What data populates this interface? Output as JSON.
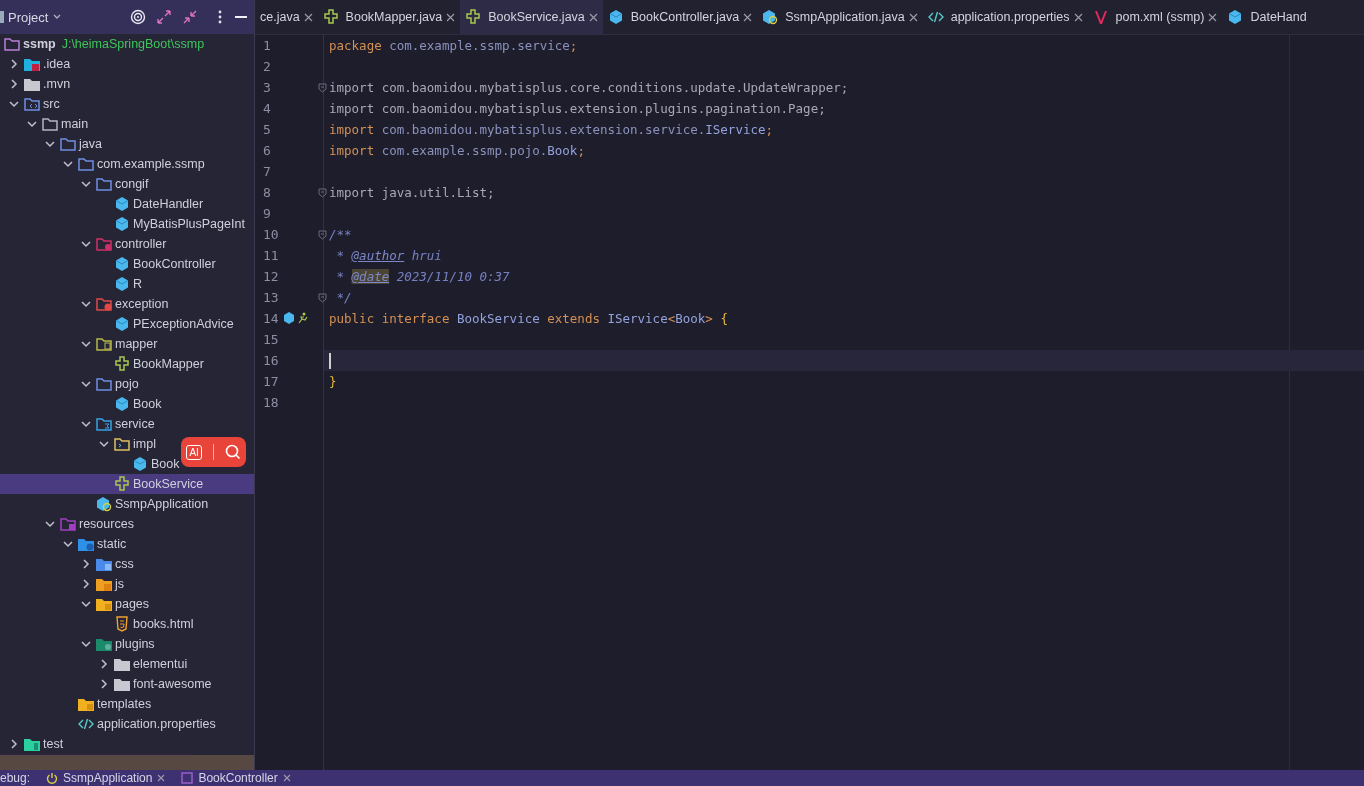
{
  "project_panel": {
    "title": "Project",
    "tree": [
      {
        "label": "ssmp",
        "path": "J:\\heimaSpringBoot\\ssmp",
        "kind": "module",
        "selected": false,
        "children": [
          {
            "label": ".idea",
            "kind": "idea-folder",
            "expanded": false,
            "selected": false
          },
          {
            "label": ".mvn",
            "kind": "plain-folder",
            "expanded": false,
            "selected": false
          },
          {
            "label": "src",
            "kind": "source-folder",
            "expanded": true,
            "selected": false,
            "children": [
              {
                "label": "main",
                "kind": "folder",
                "expanded": true,
                "selected": false,
                "children": [
                  {
                    "label": "java",
                    "kind": "package",
                    "expanded": true,
                    "selected": false,
                    "children": [
                      {
                        "label": "com.example.ssmp",
                        "kind": "package",
                        "expanded": true,
                        "selected": false,
                        "children": [
                          {
                            "label": "congif",
                            "kind": "package",
                            "expanded": true,
                            "selected": false,
                            "children": [
                              {
                                "label": "DateHandler",
                                "kind": "class",
                                "selected": false
                              },
                              {
                                "label": "MyBatisPlusPageInt",
                                "kind": "class",
                                "selected": false
                              }
                            ]
                          },
                          {
                            "label": "controller",
                            "kind": "controller-folder",
                            "expanded": true,
                            "selected": false,
                            "children": [
                              {
                                "label": "BookController",
                                "kind": "class",
                                "selected": false
                              },
                              {
                                "label": "R",
                                "kind": "class",
                                "selected": false
                              }
                            ]
                          },
                          {
                            "label": "exception",
                            "kind": "exception-folder",
                            "expanded": true,
                            "selected": false,
                            "children": [
                              {
                                "label": "PExceptionAdvice",
                                "kind": "class",
                                "selected": false
                              }
                            ]
                          },
                          {
                            "label": "mapper",
                            "kind": "mapper-folder",
                            "expanded": true,
                            "selected": false,
                            "children": [
                              {
                                "label": "BookMapper",
                                "kind": "interface",
                                "selected": false
                              }
                            ]
                          },
                          {
                            "label": "pojo",
                            "kind": "package",
                            "expanded": true,
                            "selected": false,
                            "children": [
                              {
                                "label": "Book",
                                "kind": "class",
                                "selected": false
                              }
                            ]
                          },
                          {
                            "label": "service",
                            "kind": "service-folder",
                            "expanded": true,
                            "selected": false,
                            "children": [
                              {
                                "label": "impl",
                                "kind": "impl-folder",
                                "expanded": true,
                                "selected": false,
                                "children": [
                                  {
                                    "label": "Book",
                                    "kind": "class",
                                    "selected": false
                                  }
                                ]
                              },
                              {
                                "label": "BookService",
                                "kind": "interface",
                                "selected": true
                              }
                            ]
                          },
                          {
                            "label": "SsmpApplication",
                            "kind": "app",
                            "selected": false
                          }
                        ]
                      }
                    ]
                  },
                  {
                    "label": "resources",
                    "kind": "resources-folder",
                    "expanded": true,
                    "selected": false,
                    "children": [
                      {
                        "label": "static",
                        "kind": "web-folder",
                        "expanded": true,
                        "selected": false,
                        "children": [
                          {
                            "label": "css",
                            "kind": "css-folder",
                            "expanded": false,
                            "selected": false
                          },
                          {
                            "label": "js",
                            "kind": "js-folder",
                            "expanded": false,
                            "selected": false
                          },
                          {
                            "label": "pages",
                            "kind": "yellow-folder",
                            "expanded": true,
                            "selected": false,
                            "children": [
                              {
                                "label": "books.html",
                                "kind": "html",
                                "selected": false
                              }
                            ]
                          },
                          {
                            "label": "plugins",
                            "kind": "plugin-folder",
                            "expanded": true,
                            "selected": false,
                            "children": [
                              {
                                "label": "elementui",
                                "kind": "plain-folder",
                                "expanded": false,
                                "selected": false
                              },
                              {
                                "label": "font-awesome",
                                "kind": "plain-folder",
                                "expanded": false,
                                "selected": false
                              }
                            ]
                          }
                        ]
                      },
                      {
                        "label": "templates",
                        "kind": "yellow-folder",
                        "selected": false
                      },
                      {
                        "label": "application.properties",
                        "kind": "properties",
                        "selected": false
                      }
                    ]
                  }
                ]
              }
            ]
          },
          {
            "label": "test",
            "kind": "test-folder",
            "expanded": false,
            "selected": false
          }
        ]
      }
    ]
  },
  "overlay": {
    "label": "AI"
  },
  "tabs": [
    {
      "label": "ce.java",
      "kind": "none",
      "selected": false,
      "closable": true
    },
    {
      "label": "BookMapper.java",
      "kind": "interface",
      "selected": false,
      "closable": true
    },
    {
      "label": "BookService.java",
      "kind": "interface",
      "selected": true,
      "closable": true
    },
    {
      "label": "BookController.java",
      "kind": "class",
      "selected": false,
      "closable": true
    },
    {
      "label": "SsmpApplication.java",
      "kind": "app",
      "selected": false,
      "closable": true
    },
    {
      "label": "application.properties",
      "kind": "properties",
      "selected": false,
      "closable": true
    },
    {
      "label": "pom.xml (ssmp)",
      "kind": "maven",
      "selected": false,
      "closable": true
    },
    {
      "label": "DateHand",
      "kind": "class",
      "selected": false,
      "closable": false
    }
  ],
  "editor": {
    "lines": [
      {
        "number": "1",
        "tokens": [
          {
            "text": "package ",
            "kind": "kw"
          },
          {
            "text": "com.example.ssmp.service",
            "kind": "id"
          },
          {
            "text": ";",
            "kind": "kw"
          }
        ]
      },
      {
        "number": "2"
      },
      {
        "number": "3",
        "fold": true,
        "tokens": [
          {
            "text": "import com.baomidou.mybatisplus.core.conditions.update.UpdateWrapper;",
            "kind": "unused"
          }
        ]
      },
      {
        "number": "4",
        "tokens": [
          {
            "text": "import com.baomidou.mybatisplus.extension.plugins.pagination.Page;",
            "kind": "unused"
          }
        ]
      },
      {
        "number": "5",
        "tokens": [
          {
            "text": "import ",
            "kind": "kw"
          },
          {
            "text": "com.baomidou.mybatisplus.extension.service.",
            "kind": "id"
          },
          {
            "text": "IService",
            "kind": "type"
          },
          {
            "text": ";",
            "kind": "kw"
          }
        ]
      },
      {
        "number": "6",
        "tokens": [
          {
            "text": "import ",
            "kind": "kw"
          },
          {
            "text": "com.example.ssmp.pojo.",
            "kind": "id"
          },
          {
            "text": "Book",
            "kind": "type"
          },
          {
            "text": ";",
            "kind": "kw"
          }
        ]
      },
      {
        "number": "7"
      },
      {
        "number": "8",
        "fold": true,
        "tokens": [
          {
            "text": "import java.util.List;",
            "kind": "unused"
          }
        ]
      },
      {
        "number": "9"
      },
      {
        "number": "10",
        "fold": true,
        "tokens": [
          {
            "text": "/**",
            "kind": "comment"
          }
        ]
      },
      {
        "number": "11",
        "tokens": [
          {
            "text": " * ",
            "kind": "comment"
          },
          {
            "text": "@author",
            "kind": "tag"
          },
          {
            "text": " hrui",
            "kind": "comment"
          }
        ]
      },
      {
        "number": "12",
        "tokens": [
          {
            "text": " * ",
            "kind": "comment"
          },
          {
            "text": "@date",
            "kind": "tag-hl"
          },
          {
            "text": " 2023/11/10 0:37",
            "kind": "comment"
          }
        ]
      },
      {
        "number": "13",
        "fold": true,
        "tokens": [
          {
            "text": " */",
            "kind": "comment"
          }
        ]
      },
      {
        "number": "14",
        "marker": true,
        "tokens": [
          {
            "text": "public interface ",
            "kind": "kw"
          },
          {
            "text": "BookService ",
            "kind": "type"
          },
          {
            "text": "extends ",
            "kind": "kw"
          },
          {
            "text": "IService",
            "kind": "type"
          },
          {
            "text": "<",
            "kind": "kw"
          },
          {
            "text": "Book",
            "kind": "type"
          },
          {
            "text": "> ",
            "kind": "kw"
          },
          {
            "text": "{",
            "kind": "brace"
          }
        ]
      },
      {
        "number": "15"
      },
      {
        "number": "16",
        "current": true
      },
      {
        "number": "17",
        "tokens": [
          {
            "text": "}",
            "kind": "brace"
          }
        ]
      },
      {
        "number": "18"
      }
    ]
  },
  "debug_bar": {
    "label": "ebug:",
    "tabs": [
      {
        "label": "SsmpApplication",
        "kind": "app"
      },
      {
        "label": "BookController",
        "kind": "class"
      }
    ]
  }
}
